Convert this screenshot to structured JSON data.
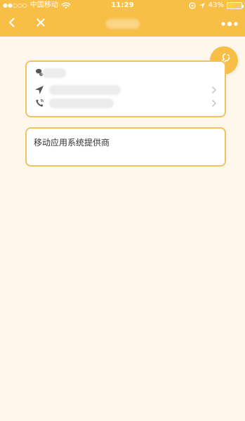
{
  "status_bar": {
    "signal_dots": "●●○○○",
    "carrier": "中国移动",
    "time": "11:29",
    "battery_percent": "43%",
    "battery_level": 0.43
  },
  "nav": {
    "title": "",
    "back_icon": "chevron-left",
    "close_icon": "close",
    "more_icon": "more-dots"
  },
  "info_card": {
    "rows": [
      {
        "icon": "wechat-icon",
        "value": ""
      },
      {
        "icon": "location-arrow-icon",
        "value": ""
      },
      {
        "icon": "phone-icon",
        "value": ""
      }
    ]
  },
  "company_card": {
    "text": "移动应用系统提供商"
  },
  "fab": {
    "icon": "wrench-icon"
  },
  "colors": {
    "accent": "#F8BF47",
    "background": "#FDF8EB",
    "card_border": "#F2C260",
    "text": "#333333"
  }
}
